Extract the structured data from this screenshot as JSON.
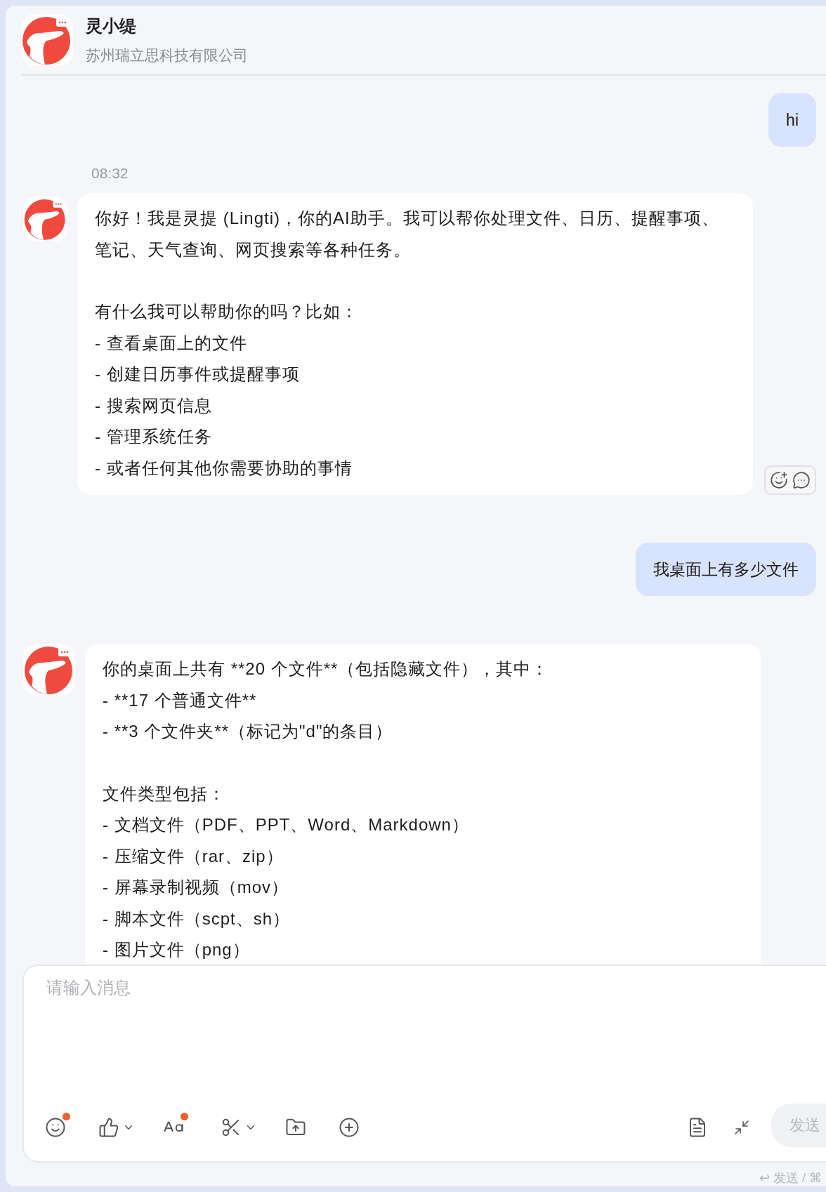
{
  "header": {
    "title": "灵小缇",
    "subtitle": "苏州瑞立思科技有限公司"
  },
  "messages": [
    {
      "kind": "user",
      "text": "hi"
    },
    {
      "kind": "time",
      "text": "08:32"
    },
    {
      "kind": "bot",
      "reactions": true,
      "paragraphs": [
        [
          "你好！我是灵提 (Lingti)，你的AI助手。我可以帮你处理文件、日历、提醒事项、笔记、天气查询、网页搜索等各种任务。"
        ],
        [
          "有什么我可以帮助你的吗？比如：",
          "- 查看桌面上的文件",
          "- 创建日历事件或提醒事项",
          "- 搜索网页信息",
          "- 管理系统任务",
          "- 或者任何其他你需要协助的事情"
        ]
      ]
    },
    {
      "kind": "user",
      "text": "我桌面上有多少文件"
    },
    {
      "kind": "bot",
      "reactions": false,
      "paragraphs": [
        [
          "你的桌面上共有 **20 个文件**（包括隐藏文件），其中：",
          "- **17 个普通文件**",
          "- **3 个文件夹**（标记为\"d\"的条目）"
        ],
        [
          "文件类型包括：",
          "- 文档文件（PDF、PPT、Word、Markdown）",
          "- 压缩文件（rar、zip）",
          "- 屏幕录制视频（mov）",
          "- 脚本文件（scpt、sh）",
          "- 图片文件（png）"
        ]
      ]
    }
  ],
  "composer": {
    "placeholder": "请输入消息",
    "send": "发送",
    "hint": "↩ 发送 / ⌘",
    "tools": [
      {
        "kind": "emoji",
        "dot": true
      },
      {
        "kind": "like",
        "dot": false
      },
      {
        "kind": "font",
        "dot": true
      },
      {
        "kind": "cut",
        "dot": false
      },
      {
        "kind": "upload",
        "dot": false
      },
      {
        "kind": "add",
        "dot": false
      }
    ]
  }
}
